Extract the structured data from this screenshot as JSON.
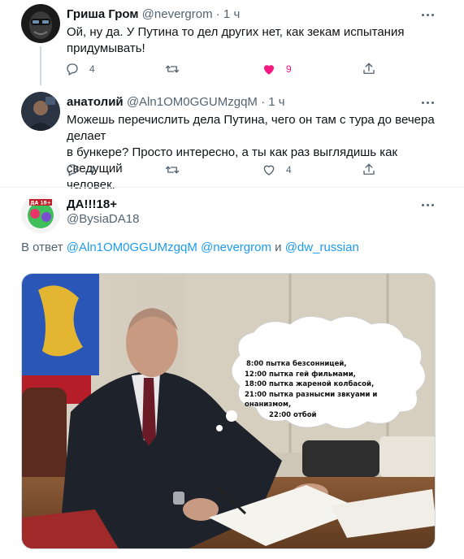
{
  "tweets": [
    {
      "name": "Гриша Гром",
      "handle": "@nevergrom",
      "time": "· 1 ч",
      "text_lines": [
        "Ой, ну да. У Путина то дел других нет, как зекам испытания",
        "придумывать!"
      ],
      "replies": "4",
      "retweets": "",
      "likes": "9",
      "liked": true
    },
    {
      "name": "анатолий",
      "handle": "@Aln1OM0GGUMzgqM",
      "time": "· 1 ч",
      "text_lines": [
        "Можешь перечислить дела Путина, чего он там с тура до вечера делает",
        "в бункере? Просто интересно, а ты как раз выглядишь как сведущий",
        "человек."
      ],
      "replies": "4",
      "retweets": "",
      "likes": "4",
      "liked": false
    }
  ],
  "main_tweet": {
    "name": "ДА!!!18+",
    "handle": "@BysiaDA18",
    "reply_prefix": "В ответ",
    "reply_handle_1": "@Aln1OM0GGUMzgqM",
    "reply_handle_2": "@nevergrom",
    "reply_and": "и",
    "reply_handle_3": "@dw_russian",
    "image": {
      "caption_lines": [
        "8:00 пытка безсонницей,",
        "12:00 пытка гей фильмами,",
        "18:00 пытка жареной колбасой,",
        "21:00 пытка разнысми звкуами и онанизмом,",
        "22:00 отбой"
      ]
    }
  },
  "icons": {
    "reply": "reply-icon",
    "retweet": "retweet-icon",
    "like": "heart-icon",
    "share": "share-icon",
    "more": "more-icon"
  },
  "colors": {
    "accent": "#1d9bf0",
    "like": "#f91880",
    "muted": "#536471"
  }
}
